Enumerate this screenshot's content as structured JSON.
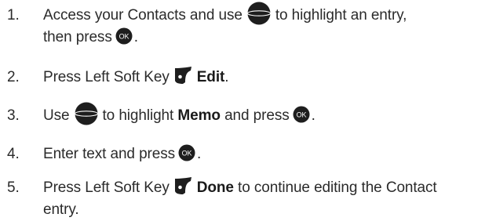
{
  "steps": [
    {
      "num": "1.",
      "line1_a": "Access your Contacts and use",
      "line1_b": "to highlight an entry,",
      "line2_a": "then press",
      "line2_b": "."
    },
    {
      "num": "2.",
      "a": "Press Left Soft Key",
      "bold": "Edit",
      "b": "."
    },
    {
      "num": "3.",
      "a": "Use",
      "b": "to highlight",
      "bold": "Memo",
      "c": "and press",
      "d": "."
    },
    {
      "num": "4.",
      "a": "Enter text and press",
      "b": "."
    },
    {
      "num": "5.",
      "a": "Press Left Soft Key",
      "bold": "Done",
      "b": "to continue editing the Contact",
      "line2": "entry."
    }
  ],
  "icons": {
    "nav": "navigation-key-icon",
    "ok": "ok-key-icon",
    "left_soft_key": "left-soft-key-icon",
    "ok_label": "OK",
    "icon_color": "#1e1e1e"
  }
}
